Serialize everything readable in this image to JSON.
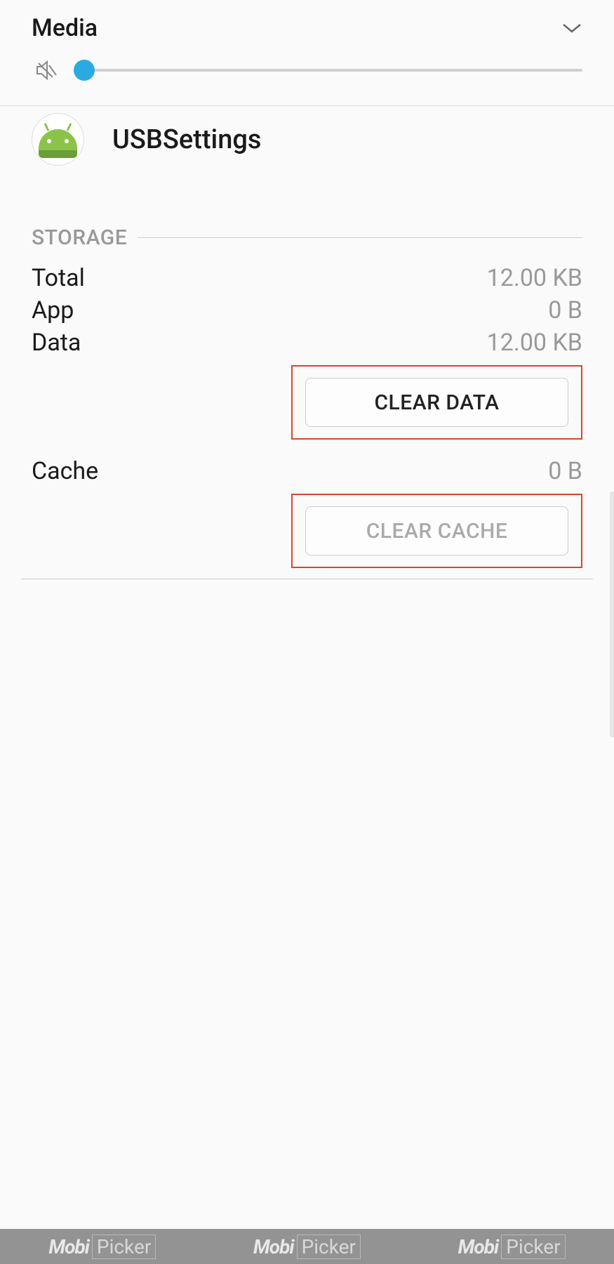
{
  "volumePanel": {
    "title": "Media"
  },
  "app": {
    "name": "USBSettings"
  },
  "storage": {
    "sectionTitle": "STORAGE",
    "rows": [
      {
        "label": "Total",
        "value": "12.00 KB"
      },
      {
        "label": "App",
        "value": "0 B"
      },
      {
        "label": "Data",
        "value": "12.00 KB"
      }
    ],
    "clearDataLabel": "CLEAR DATA",
    "cacheLabel": "Cache",
    "cacheValue": "0 B",
    "clearCacheLabel": "CLEAR CACHE"
  },
  "watermark": {
    "brand1": "Mobi",
    "brand2": "Picker"
  }
}
